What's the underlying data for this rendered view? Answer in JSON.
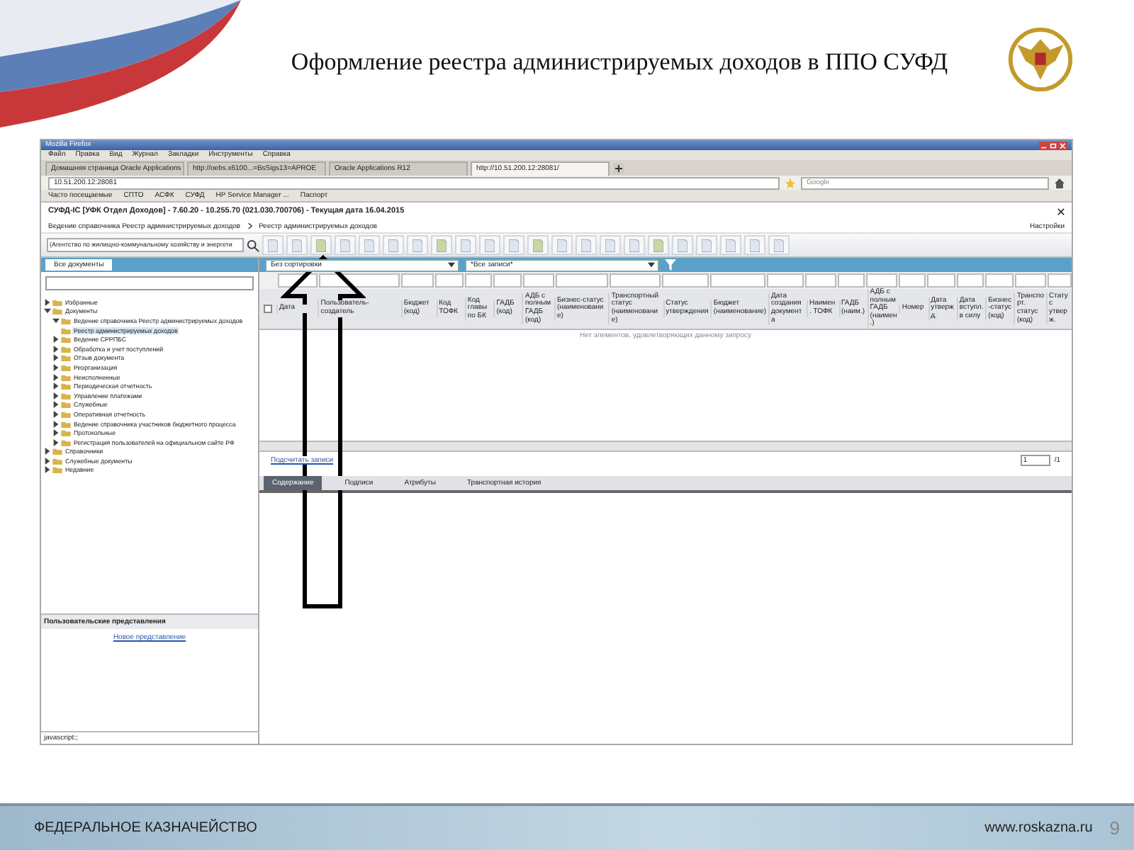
{
  "slide": {
    "title": "Оформление реестра администрируемых доходов в ППО СУФД",
    "footer_org": "ФЕДЕРАЛЬНОЕ КАЗНАЧЕЙСТВО",
    "footer_url": "www.roskazna.ru",
    "page_number": "9"
  },
  "browser": {
    "title": "Mozilla Firefox",
    "menu": [
      "Файл",
      "Правка",
      "Вид",
      "Журнал",
      "Закладки",
      "Инструменты",
      "Справка"
    ],
    "tabs": [
      {
        "label": "Домашняя страница Oracle Applications",
        "selected": false
      },
      {
        "label": "http://oebs.x6100...=BsSigs13=APROE",
        "selected": false
      },
      {
        "label": "Oracle Applications R12",
        "selected": false
      },
      {
        "label": "http://10.51.200.12:28081/",
        "selected": true
      }
    ],
    "url": "10.51.200.12:28081",
    "search_placeholder": "Google",
    "bookmarks": [
      "Часто посещаемые",
      "СПТО",
      "АСФК",
      "СУФД",
      "HP Service Manager ...",
      "Паспорт"
    ]
  },
  "app": {
    "title": "СУФД-IC [УФК Отдел Доходов] - 7.60.20 - 10.255.70 (021.030.700706) - Текущая дата 16.04.2015",
    "breadcrumb": [
      "Ведение справочника Реестр администрируемых доходов",
      "Реестр администрируемых доходов"
    ],
    "settings_label": "Настройки",
    "org_field": "(Агентство по жилищно-коммунальному хозяйству и энергети",
    "left_tabs": [
      {
        "label": "Все документы",
        "selected": true
      }
    ],
    "tree": [
      {
        "label": "Избранные",
        "expanded": false,
        "selected": false
      },
      {
        "label": "Документы",
        "expanded": true,
        "selected": false,
        "children": [
          {
            "label": "Ведение справочника Реестр администрируемых доходов",
            "expanded": true,
            "selected": false,
            "children": [
              {
                "label": "Реестр администрируемых доходов",
                "selected": true
              }
            ]
          },
          {
            "label": "Ведение СРРПБС",
            "expanded": false,
            "selected": false
          },
          {
            "label": "Обработка и учет поступлений",
            "expanded": false,
            "selected": false
          },
          {
            "label": "Отзыв документа",
            "expanded": false,
            "selected": false
          },
          {
            "label": "Реорганизация",
            "expanded": false,
            "selected": false
          },
          {
            "label": "Неисполненные",
            "expanded": false,
            "selected": false
          },
          {
            "label": "Периодическая отчетность",
            "expanded": false,
            "selected": false
          },
          {
            "label": "Управление платежами",
            "expanded": false,
            "selected": false
          },
          {
            "label": "Служебные",
            "expanded": false,
            "selected": false
          },
          {
            "label": "Оперативная отчетность",
            "expanded": false,
            "selected": false
          },
          {
            "label": "Ведение справочника участников бюджетного процесса",
            "expanded": false,
            "selected": false
          },
          {
            "label": "Протокольные",
            "expanded": false,
            "selected": false
          },
          {
            "label": "Регистрация пользователей на официальном сайте РФ",
            "expanded": false,
            "selected": false
          }
        ]
      },
      {
        "label": "Справочники",
        "expanded": false,
        "selected": false
      },
      {
        "label": "Служебные документы",
        "expanded": false,
        "selected": false
      },
      {
        "label": "Недавние",
        "expanded": false,
        "selected": false
      }
    ],
    "views_panel": {
      "title": "Пользовательские представления",
      "link": "Новое представление"
    },
    "grid": {
      "select_all_checked": false,
      "sort": "Без сортировки",
      "filter": "*Все записи*",
      "columns": [
        "Дата",
        "Пользователь-создатель",
        "Бюджет (код)",
        "Код ТОФК",
        "Код главы по БК",
        "ГАДБ (код)",
        "АДБ с полным ГАДБ (код)",
        "Бизнес-статус (наименование)",
        "Транспортный статус (наименование)",
        "Статус утверждения",
        "Бюджет (наименование)",
        "Дата создания документа",
        "Наимен. ТОФК",
        "ГАДБ (наим.)",
        "АДБ с полным ГАДБ (наимен.)",
        "Номер",
        "Дата утвержд.",
        "Дата вступл. в силу",
        "Бизнес-статус (код)",
        "Транспорт. статус (код)",
        "Статус утверж."
      ],
      "empty_message": "Нет элементов, удовлетворяющих данному запросу",
      "count_link": "Подсчитать записи",
      "page": "1",
      "page_total": "/1"
    },
    "bottom_tabs": [
      {
        "label": "Содержание",
        "selected": true
      },
      {
        "label": "Подписи",
        "selected": false
      },
      {
        "label": "Атрибуты",
        "selected": false
      },
      {
        "label": "Транспортная история",
        "selected": false
      }
    ],
    "status": "javascript:;"
  }
}
